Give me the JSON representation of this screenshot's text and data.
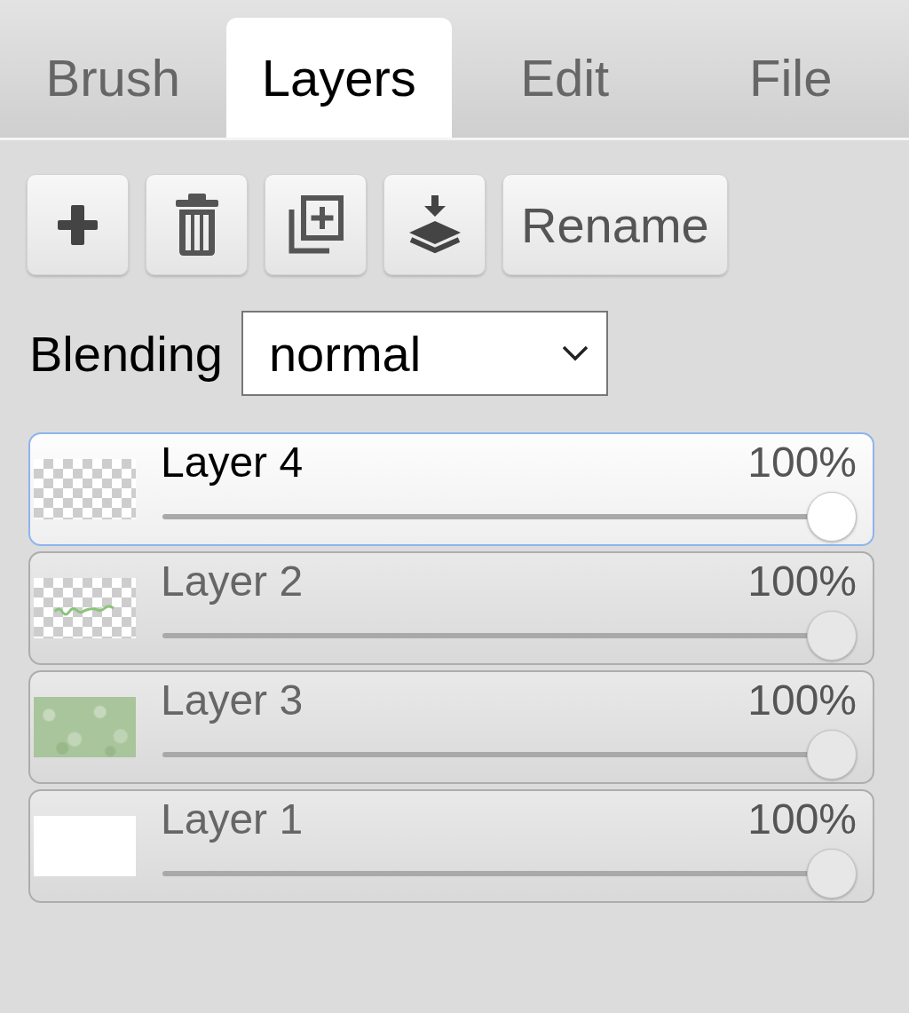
{
  "tabs": [
    {
      "label": "Brush",
      "selected": false
    },
    {
      "label": "Layers",
      "selected": true
    },
    {
      "label": "Edit",
      "selected": false
    },
    {
      "label": "File",
      "selected": false
    }
  ],
  "toolbar": {
    "rename_button": "Rename"
  },
  "blending": {
    "label": "Blending",
    "value": "normal"
  },
  "layers": [
    {
      "name": "Layer 4",
      "opacity": "100%",
      "level": 1,
      "selected": true,
      "kind": "transparent"
    },
    {
      "name": "Layer 2",
      "opacity": "100%",
      "level": 1,
      "selected": false,
      "kind": "sketch"
    },
    {
      "name": "Layer 3",
      "opacity": "100%",
      "level": 1,
      "selected": false,
      "kind": "texture"
    },
    {
      "name": "Layer 1",
      "opacity": "100%",
      "level": 1,
      "selected": false,
      "kind": "solid"
    }
  ]
}
